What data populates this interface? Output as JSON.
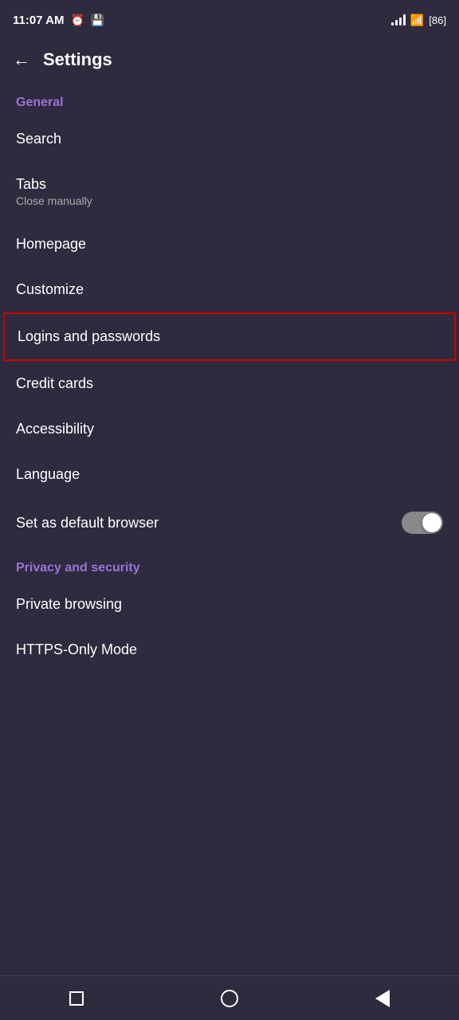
{
  "statusBar": {
    "time": "11:07 AM",
    "alarmIcon": "alarm-icon",
    "saveIcon": "save-icon",
    "batteryLevel": "86"
  },
  "header": {
    "backLabel": "←",
    "title": "Settings"
  },
  "general": {
    "sectionLabel": "General",
    "items": [
      {
        "id": "search",
        "title": "Search",
        "subtitle": null
      },
      {
        "id": "tabs",
        "title": "Tabs",
        "subtitle": "Close manually"
      },
      {
        "id": "homepage",
        "title": "Homepage",
        "subtitle": null
      },
      {
        "id": "customize",
        "title": "Customize",
        "subtitle": null
      },
      {
        "id": "logins",
        "title": "Logins and passwords",
        "subtitle": null,
        "highlighted": true
      },
      {
        "id": "credit-cards",
        "title": "Credit cards",
        "subtitle": null
      },
      {
        "id": "accessibility",
        "title": "Accessibility",
        "subtitle": null
      },
      {
        "id": "language",
        "title": "Language",
        "subtitle": null
      },
      {
        "id": "default-browser",
        "title": "Set as default browser",
        "subtitle": null,
        "hasToggle": true,
        "toggleOn": false
      }
    ]
  },
  "privacySecurity": {
    "sectionLabel": "Privacy and security",
    "items": [
      {
        "id": "private-browsing",
        "title": "Private browsing",
        "subtitle": null
      },
      {
        "id": "https-only",
        "title": "HTTPS-Only Mode",
        "subtitle": null
      }
    ]
  },
  "navBar": {
    "squareLabel": "square-nav",
    "circleLabel": "circle-nav",
    "triangleLabel": "back-nav"
  }
}
